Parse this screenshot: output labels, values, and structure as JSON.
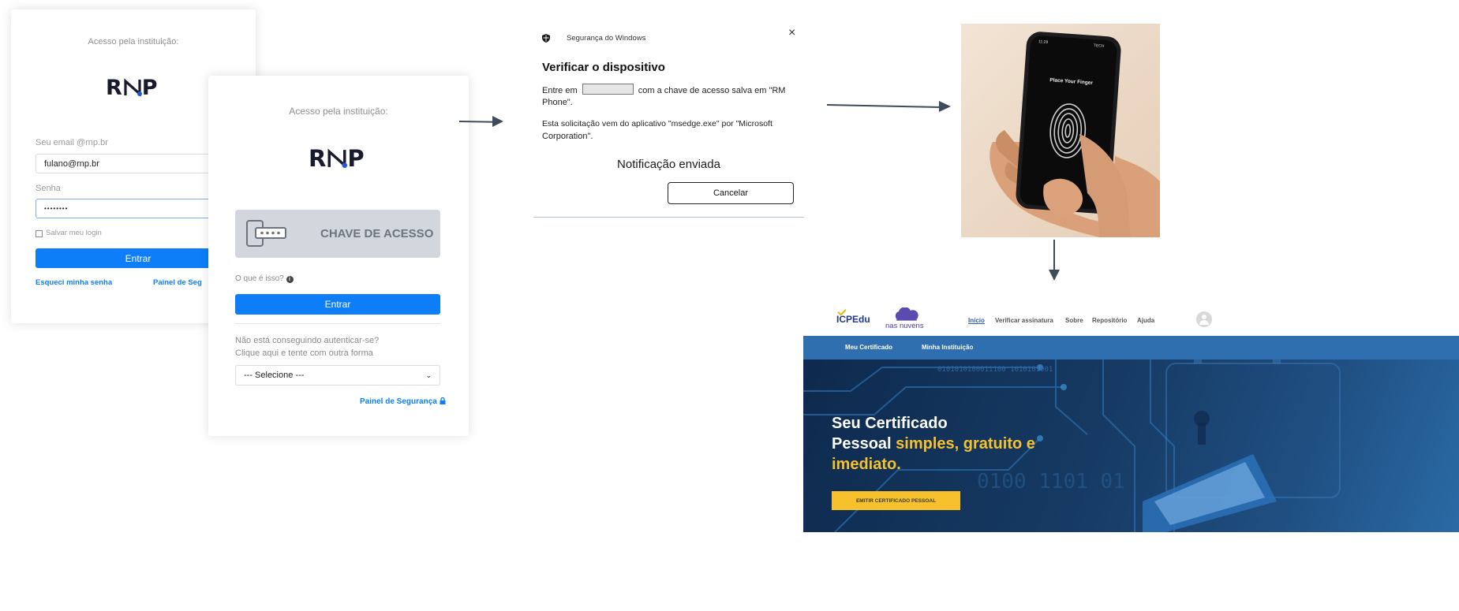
{
  "login_card_1": {
    "institution_label": "Acesso pela instituição:",
    "logo_text_left": "R",
    "logo_text_right": "P",
    "email_label": "Seu email @rnp.br",
    "email_value": "fulano@rnp.br",
    "password_label": "Senha",
    "password_value": "••••••••",
    "remember_label": "Salvar meu login",
    "submit_label": "Entrar",
    "forgot_link": "Esqueci minha senha",
    "security_link": "Painel de Seg"
  },
  "login_card_2": {
    "institution_label": "Acesso pela instituição:",
    "logo_text_left": "R",
    "logo_text_right": "P",
    "passkey_label": "CHAVE DE ACESSO",
    "what_is_label": "O que é isso?",
    "submit_label": "Entrar",
    "trouble_line_1": "Não está conseguindo autenticar-se?",
    "trouble_line_2": "Clique aqui e tente com outra forma",
    "select_value": "--- Selecione ---",
    "security_link": "Painel de Segurança"
  },
  "windows_dialog": {
    "app_title": "Segurança do Windows",
    "heading": "Verificar o dispositivo",
    "line_1_prefix": "Entre em",
    "line_1_suffix": "com a chave de acesso salva em \"RM",
    "line_2": "Phone\".",
    "line_3": "Esta solicitação vem do aplicativo \"msedge.exe\" por \"Microsoft",
    "line_4": "Corporation\".",
    "status": "Notificação enviada",
    "cancel_label": "Cancelar",
    "close_label": "×"
  },
  "phone_photo": {
    "time": "11:28",
    "status_right": "TECH",
    "prompt": "Place Your Finger"
  },
  "icpedu_site": {
    "logo_main": "ICPEdu",
    "logo_sub": "nas nuvens",
    "nav": [
      "Início",
      "Verificar assinatura",
      "Sobre",
      "Repositório",
      "Ajuda"
    ],
    "subnav": [
      "Meu Certificado",
      "Minha Instituição"
    ],
    "hero_line_1": "Seu Certificado",
    "hero_line_2_white": "Pessoal",
    "hero_line_2_yellow": "simples, gratuito e",
    "hero_line_3": "imediato.",
    "cta_label": "EMITIR CERTIFICADO PESSOAL",
    "binary_text": "0101010100011100 1010101001",
    "binary_text_2": "0100 1101 01",
    "colors": {
      "nav_blue": "#2f6fb0",
      "hero_dark": "#0e2a4e",
      "accent_yellow": "#f6c12c"
    }
  },
  "colors": {
    "primary_blue": "#0d7ef8",
    "passkey_bg": "#d2d7dd",
    "arrow": "#3d4b5c"
  }
}
